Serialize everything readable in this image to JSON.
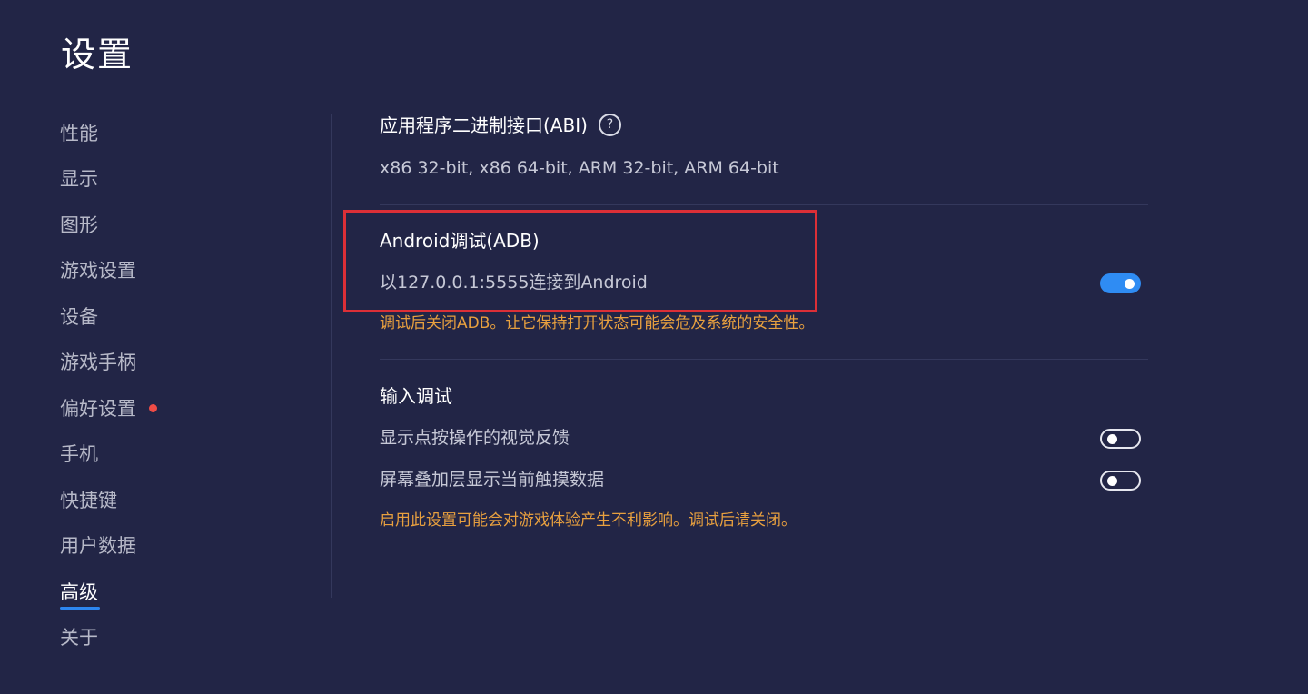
{
  "header": {
    "title": "设置"
  },
  "sidebar": {
    "items": [
      {
        "label": "性能"
      },
      {
        "label": "显示"
      },
      {
        "label": "图形"
      },
      {
        "label": "游戏设置"
      },
      {
        "label": "设备"
      },
      {
        "label": "游戏手柄"
      },
      {
        "label": "偏好设置",
        "has_notification": true
      },
      {
        "label": "手机"
      },
      {
        "label": "快捷键"
      },
      {
        "label": "用户数据"
      },
      {
        "label": "高级",
        "active": true
      },
      {
        "label": "关于"
      }
    ]
  },
  "main": {
    "abi": {
      "title": "应用程序二进制接口(ABI)",
      "help_icon": "?",
      "value": "x86 32-bit, x86 64-bit, ARM 32-bit, ARM 64-bit"
    },
    "adb": {
      "title": "Android调试(ADB)",
      "description": "以127.0.0.1:5555连接到Android",
      "enabled": true,
      "warning": "调试后关闭ADB。让它保持打开状态可能会危及系统的安全性。"
    },
    "input_debug": {
      "title": "输入调试",
      "options": [
        {
          "label": "显示点按操作的视觉反馈",
          "enabled": false
        },
        {
          "label": "屏幕叠加层显示当前触摸数据",
          "enabled": false
        }
      ],
      "warning": "启用此设置可能会对游戏体验产生不利影响。调试后请关闭。"
    }
  },
  "colors": {
    "background": "#222546",
    "accent": "#2f8cf3",
    "warning": "#e8a03f",
    "highlight_box": "#dc2f37",
    "notification_dot": "#ef4c46"
  },
  "icons": {
    "help": "question-circle-icon",
    "notification": "red-dot"
  }
}
